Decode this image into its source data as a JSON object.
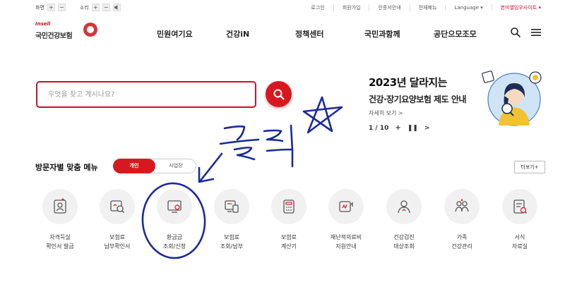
{
  "util_bar": {
    "font_size_label": "화면",
    "zoom_plus": "+",
    "zoom_minus": "−",
    "sound_label": "소리",
    "sound_plus": "+",
    "sound_minus": "−",
    "links": [
      "로그인",
      "회원가입",
      "인증서안내",
      "전체메뉴",
      "Language ▾",
      "본미엘임우사이트 ▾"
    ]
  },
  "header": {
    "logo_small": "Insell",
    "logo_text": "국민건강보험",
    "nav": [
      "민원여기요",
      "건강iN",
      "정책센터",
      "국민과함께",
      "공단으모조모"
    ]
  },
  "search": {
    "placeholder": "무엇을 찾고 계시나요?"
  },
  "banner": {
    "title": "2023년 달라지는",
    "subtitle": "건강·장기요양보험 제도 안내",
    "more": "자세히 보기 >",
    "page": "1 / 10",
    "plus": "+",
    "pause": "❚❚",
    "next": ">"
  },
  "visitor_menu": {
    "title": "방문자별 맞춤 메뉴",
    "tab_personal": "개인",
    "tab_business": "사업장",
    "more": "더보기+",
    "items": [
      {
        "label": "자격득실\n확인서 발급",
        "icon": "certificate-icon"
      },
      {
        "label": "보험료\n납부확인서",
        "icon": "payment-confirm-icon"
      },
      {
        "label": "환급금\n조회/신청",
        "icon": "refund-icon"
      },
      {
        "label": "보험료\n조회/납부",
        "icon": "premium-payment-icon"
      },
      {
        "label": "보험료\n계산기",
        "icon": "calculator-icon"
      },
      {
        "label": "재난적의료비\n지원안내",
        "icon": "medical-support-icon"
      },
      {
        "label": "건강검진\n대상조회",
        "icon": "checkup-icon"
      },
      {
        "label": "가족\n건강관리",
        "icon": "family-icon"
      },
      {
        "label": "서식\n자료실",
        "icon": "forms-icon"
      }
    ]
  },
  "annotation": {
    "handwritten_text": "클릭",
    "color": "#1a2a9c"
  },
  "colors": {
    "brand_red": "#d7191f",
    "icon_bg": "#f1f1f1"
  }
}
